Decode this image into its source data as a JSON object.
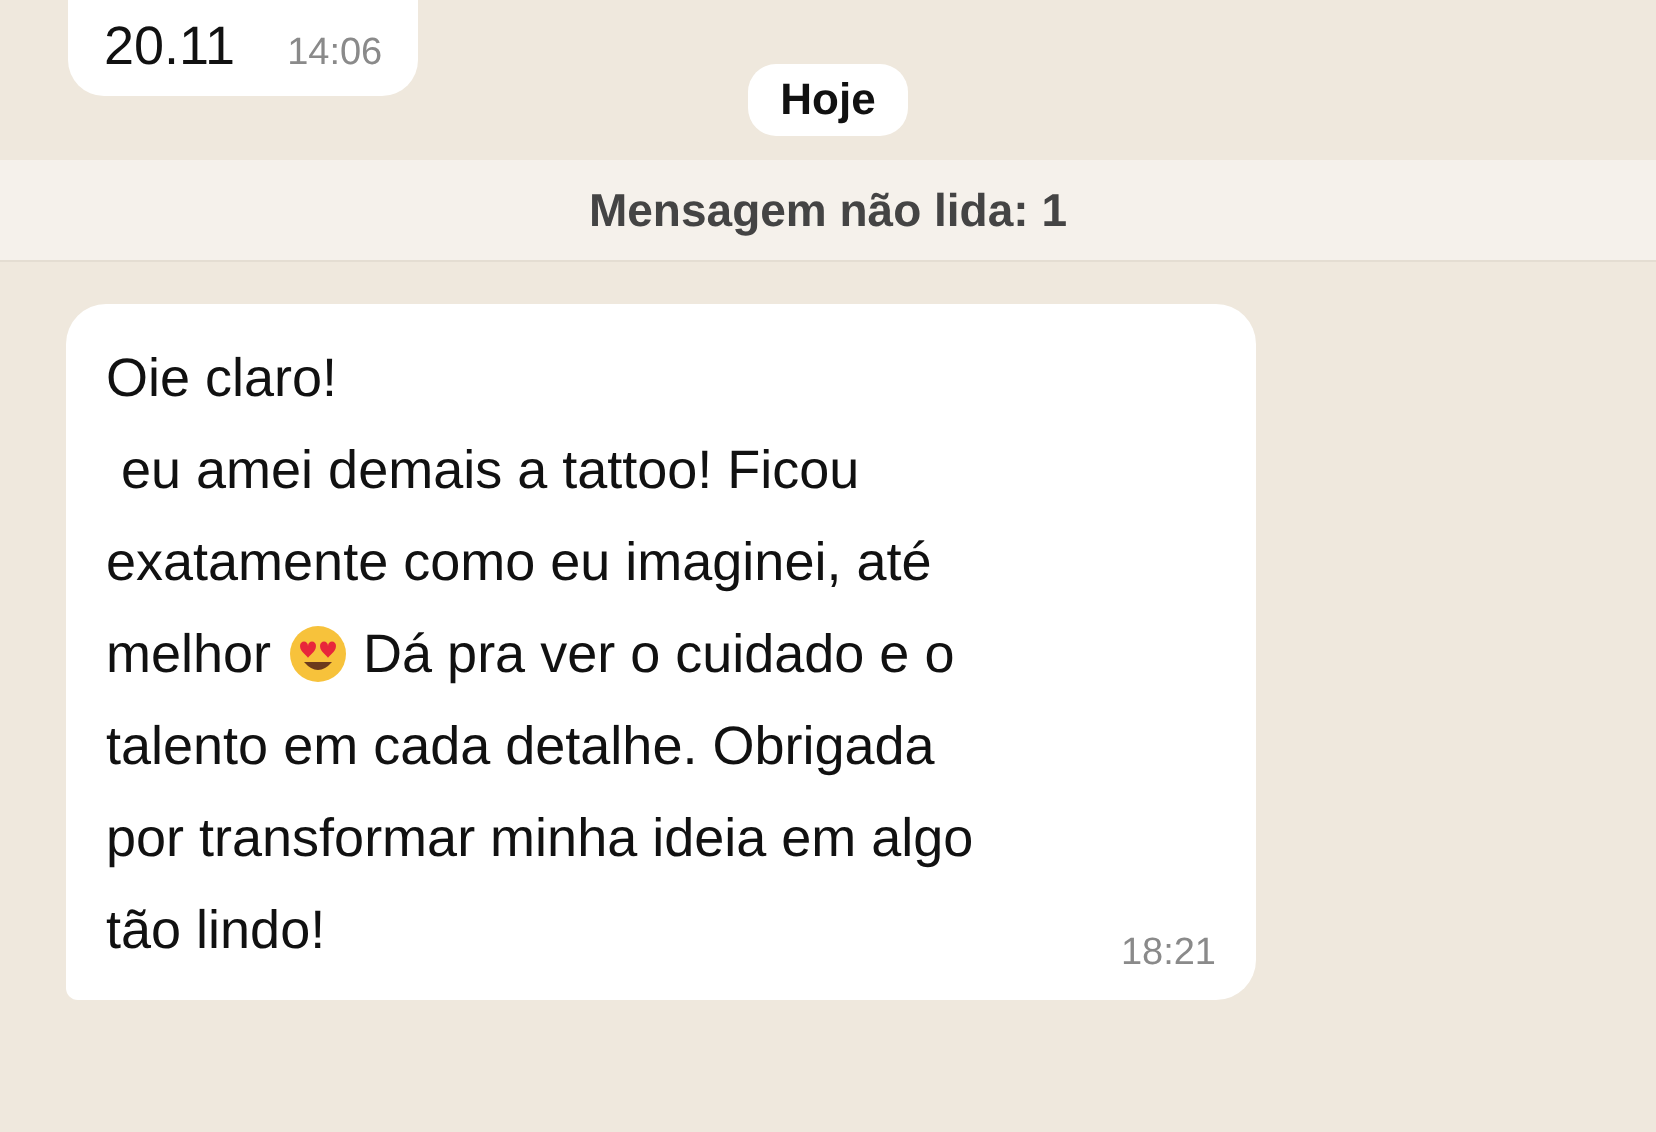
{
  "previous_message": {
    "text": "20.11",
    "time": "14:06"
  },
  "date_divider": "Hoje",
  "unread_banner": "Mensagem não lida: 1",
  "message": {
    "time": "18:21",
    "lines": [
      [
        {
          "kind": "text",
          "text": "Oie claro!"
        }
      ],
      [
        {
          "kind": "text",
          "text": " eu amei demais a tattoo! Ficou"
        }
      ],
      [
        {
          "kind": "text",
          "text": "exatamente como eu imaginei, até"
        }
      ],
      [
        {
          "kind": "text",
          "text": "melhor"
        },
        {
          "kind": "emoji"
        },
        {
          "kind": "text",
          "text": "Dá pra ver o cuidado e o"
        }
      ],
      [
        {
          "kind": "text",
          "text": "talento em cada detalhe. Obrigada"
        }
      ],
      [
        {
          "kind": "text",
          "text": "por transformar minha ideia em algo"
        }
      ],
      [
        {
          "kind": "text",
          "text": "tão lindo!"
        }
      ]
    ]
  }
}
